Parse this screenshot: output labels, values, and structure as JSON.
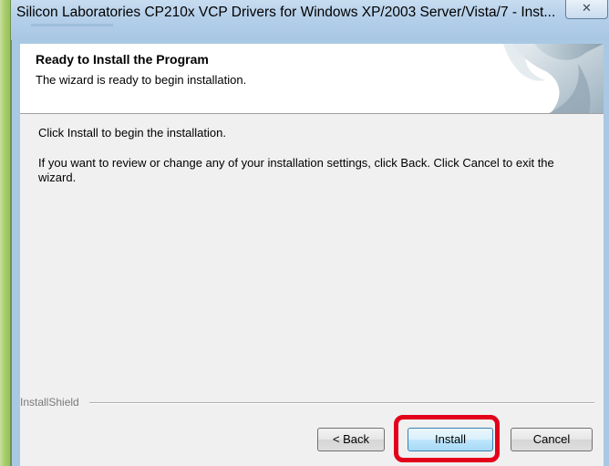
{
  "window": {
    "title": "Silicon Laboratories CP210x VCP Drivers for Windows XP/2003 Server/Vista/7 - Inst...",
    "close_glyph": "✕"
  },
  "header": {
    "title": "Ready to Install the Program",
    "subtitle": "The wizard is ready to begin installation."
  },
  "body": {
    "line1": "Click Install to begin the installation.",
    "line2": "If you want to review or change any of your installation settings, click Back. Click Cancel to exit the wizard."
  },
  "footer": {
    "brand": "InstallShield"
  },
  "buttons": {
    "back": "< Back",
    "install": "Install",
    "cancel": "Cancel"
  },
  "colors": {
    "highlight": "#e3001b",
    "title_bar": "#b6d0ea",
    "dialog_bg": "#f0f0f0"
  }
}
